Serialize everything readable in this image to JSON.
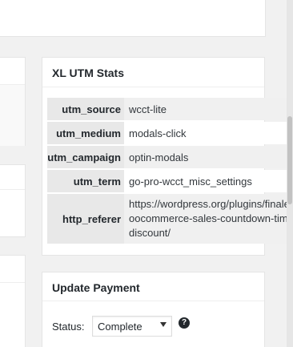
{
  "utm_box": {
    "title": "XL UTM Stats",
    "rows": [
      {
        "key": "utm_source",
        "value": "wcct-lite"
      },
      {
        "key": "utm_medium",
        "value": "modals-click"
      },
      {
        "key": "utm_campaign",
        "value": "optin-modals"
      },
      {
        "key": "utm_term",
        "value": "go-pro-wcct_misc_settings"
      },
      {
        "key": "http_referer",
        "value": "https://wordpress.org/plugins/finale-woocommerce-sales-countdown-timer-discount/"
      }
    ]
  },
  "payment_box": {
    "title": "Update Payment",
    "status_label": "Status:",
    "status_value": "Complete",
    "help_icon": "?"
  }
}
